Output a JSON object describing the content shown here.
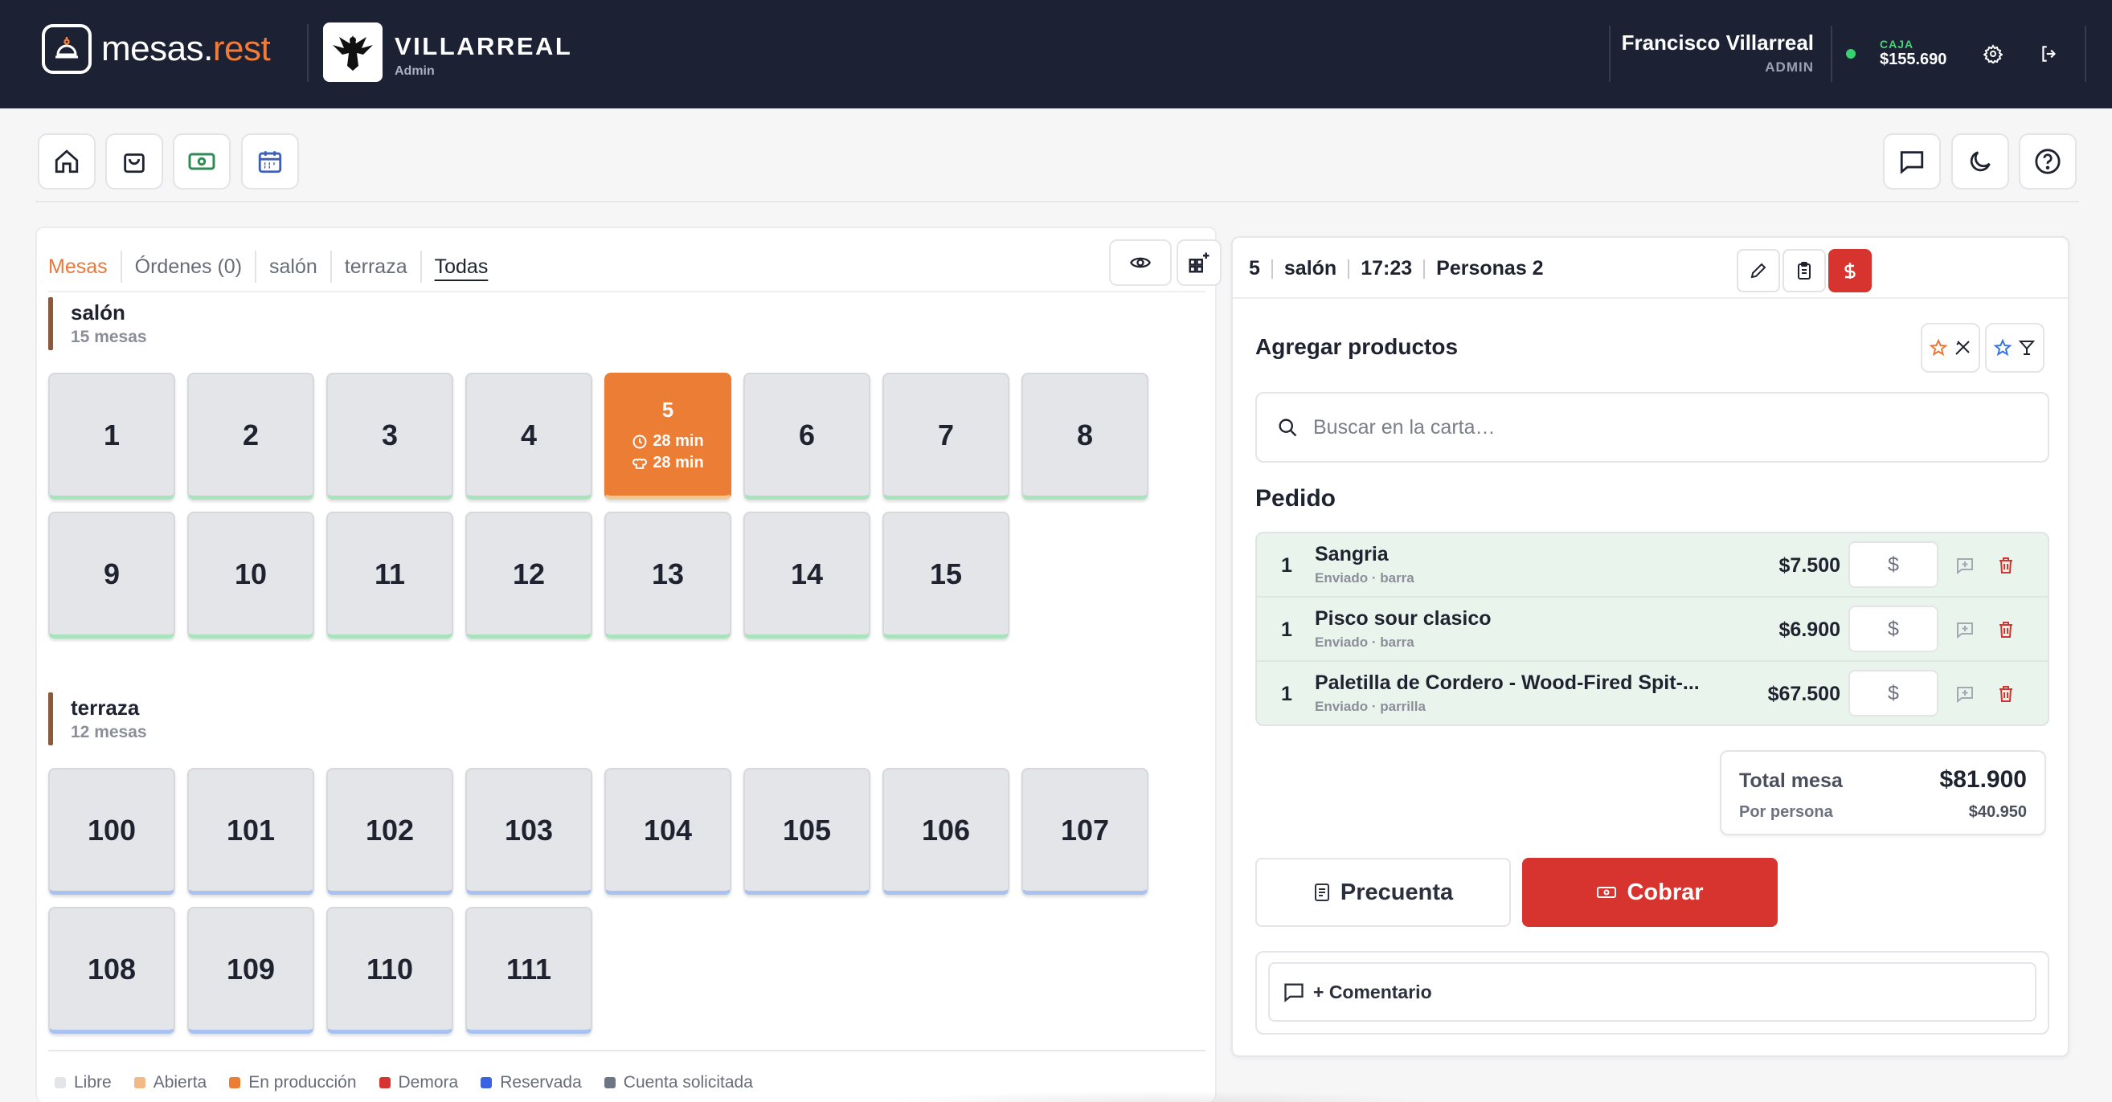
{
  "topbar": {
    "brand_main": "mesas.",
    "brand_accent": "rest",
    "restaurant_name": "VILLARREAL",
    "restaurant_role": "Admin",
    "user_name": "Francisco Villarreal",
    "user_role": "ADMIN",
    "caja_label": "CAJA",
    "caja_value": "$155.690",
    "caja_status_color": "#34d36e"
  },
  "toolbar": {
    "left_icons": [
      "home-icon",
      "shopping-bag-icon",
      "cash-icon",
      "calendar-icon"
    ],
    "right_icons": [
      "chat-icon",
      "moon-icon",
      "help-icon"
    ]
  },
  "tabs": [
    {
      "label": "Mesas",
      "state": "active"
    },
    {
      "label": "Órdenes (0)",
      "state": "normal"
    },
    {
      "label": "salón",
      "state": "normal"
    },
    {
      "label": "terraza",
      "state": "normal"
    },
    {
      "label": "Todas",
      "state": "selected"
    }
  ],
  "sections": [
    {
      "name": "salón",
      "count": "15 mesas",
      "tables": [
        "1",
        "2",
        "3",
        "4",
        "5",
        "6",
        "7",
        "8",
        "9",
        "10",
        "11",
        "12",
        "13",
        "14",
        "15"
      ],
      "active_table": {
        "number": "5",
        "time_open": "28 min",
        "time_kitchen": "28 min"
      }
    },
    {
      "name": "terraza",
      "count": "12 mesas",
      "tables": [
        "100",
        "101",
        "102",
        "103",
        "104",
        "105",
        "106",
        "107",
        "108",
        "109",
        "110",
        "111"
      ]
    }
  ],
  "legend": [
    {
      "label": "Libre",
      "color": "#e4e5e8"
    },
    {
      "label": "Abierta",
      "color": "#f2b985"
    },
    {
      "label": "En producción",
      "color": "#ec7d35"
    },
    {
      "label": "Demora",
      "color": "#d7342f"
    },
    {
      "label": "Reservada",
      "color": "#3b62e0"
    },
    {
      "label": "Cuenta solicitada",
      "color": "#6e7585"
    }
  ],
  "order": {
    "table": "5",
    "zone": "salón",
    "time": "17:23",
    "people": "Personas 2",
    "add_title": "Agregar productos",
    "search_placeholder": "Buscar en la carta…",
    "pedido_title": "Pedido",
    "items": [
      {
        "qty": "1",
        "name": "Sangria",
        "sub": "Enviado · barra",
        "price": "$7.500",
        "input": "$"
      },
      {
        "qty": "1",
        "name": "Pisco sour clasico",
        "sub": "Enviado · barra",
        "price": "$6.900",
        "input": "$"
      },
      {
        "qty": "1",
        "name": "Paletilla de Cordero - Wood-Fired Spit-...",
        "sub": "Enviado · parrilla",
        "price": "$67.500",
        "input": "$"
      }
    ],
    "total_label": "Total mesa",
    "total_value": "$81.900",
    "per_person_label": "Por persona",
    "per_person_value": "$40.950",
    "precuenta_label": "Precuenta",
    "cobrar_label": "Cobrar",
    "comment_label": "+ Comentario",
    "accent_color": "#d7342f"
  }
}
